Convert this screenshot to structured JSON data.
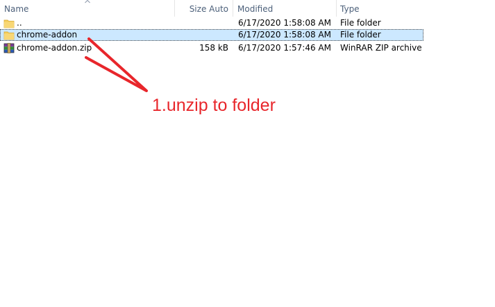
{
  "columns": {
    "name": "Name",
    "size": "Size Auto",
    "modified": "Modified",
    "type": "Type"
  },
  "rows": [
    {
      "name": "..",
      "size": "",
      "modified": "6/17/2020 1:58:08 AM",
      "type": "File folder",
      "icon": "folder-icon",
      "selected": false
    },
    {
      "name": "chrome-addon",
      "size": "",
      "modified": "6/17/2020 1:58:08 AM",
      "type": "File folder",
      "icon": "folder-icon",
      "selected": true
    },
    {
      "name": "chrome-addon.zip",
      "size": "158 kB",
      "modified": "6/17/2020 1:57:46 AM",
      "type": "WinRAR ZIP archive",
      "icon": "winrar-archive-icon",
      "selected": false
    }
  ],
  "annotation": {
    "text": "1.unzip to folder",
    "color": "#e8262b"
  },
  "colors": {
    "selection": "#cce8ff",
    "header_text": "#4c607a",
    "folder": "#f3cd5a"
  }
}
